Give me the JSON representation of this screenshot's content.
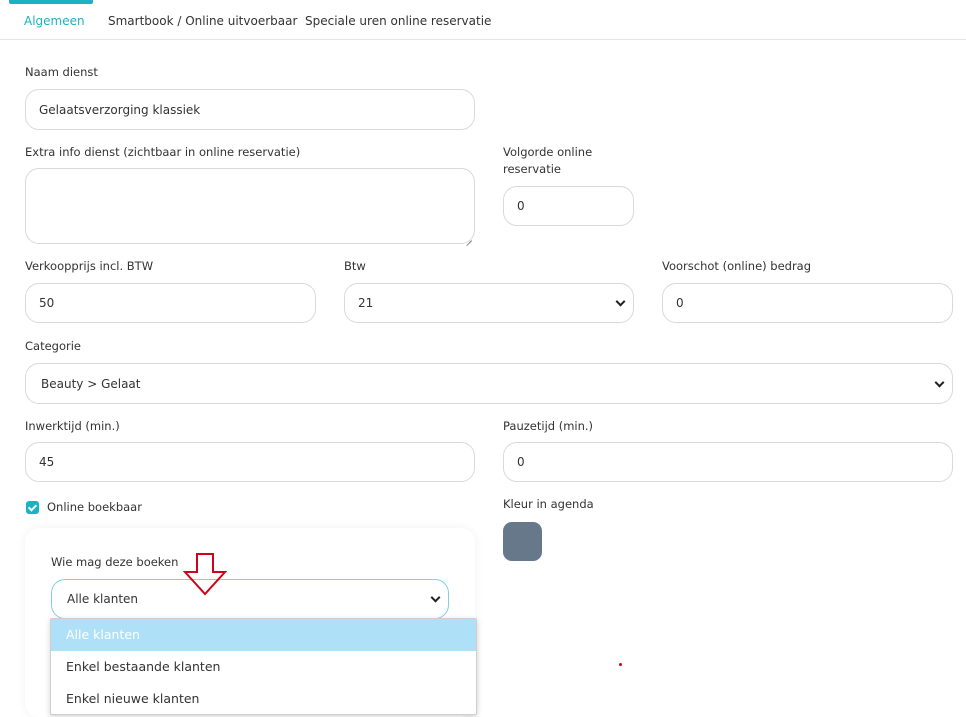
{
  "tabs": [
    {
      "label": "Algemeen",
      "active": true
    },
    {
      "label": "Smartbook / Online uitvoerbaar",
      "active": false
    },
    {
      "label": "Speciale uren online reservatie",
      "active": false
    }
  ],
  "form": {
    "naam_dienst": {
      "label": "Naam dienst",
      "value": "Gelaatsverzorging klassiek"
    },
    "extra_info": {
      "label": "Extra info dienst (zichtbaar in online reservatie)",
      "value": ""
    },
    "volgorde": {
      "label_line1": "Volgorde online",
      "label_line2": "reservatie",
      "value": "0"
    },
    "verkoopprijs": {
      "label": "Verkoopprijs incl. BTW",
      "value": "50"
    },
    "btw": {
      "label": "Btw",
      "value": "21"
    },
    "voorschot": {
      "label": "Voorschot (online) bedrag",
      "value": "0"
    },
    "categorie": {
      "label": "Categorie",
      "value": "Beauty > Gelaat"
    },
    "inwerktijd": {
      "label": "Inwerktijd (min.)",
      "value": "45"
    },
    "pauzetijd": {
      "label": "Pauzetijd (min.)",
      "value": "0"
    },
    "online_boekbaar": {
      "label": "Online boekbaar",
      "checked": true
    },
    "kleur": {
      "label": "Kleur in agenda",
      "color": "#66788a"
    },
    "wie_mag": {
      "label": "Wie mag deze boeken",
      "value": "Alle klanten",
      "options": [
        "Alle klanten",
        "Enkel bestaande klanten",
        "Enkel nieuwe klanten"
      ],
      "highlighted_index": 0
    }
  },
  "colors": {
    "accent": "#1bb3c4",
    "annotation_arrow": "#d0021b",
    "dropdown_highlight": "#aee0f7"
  },
  "icons": {
    "annotation": "arrow-down-outline-icon",
    "select": "chevron-down-icon",
    "checkbox": "check-icon"
  }
}
